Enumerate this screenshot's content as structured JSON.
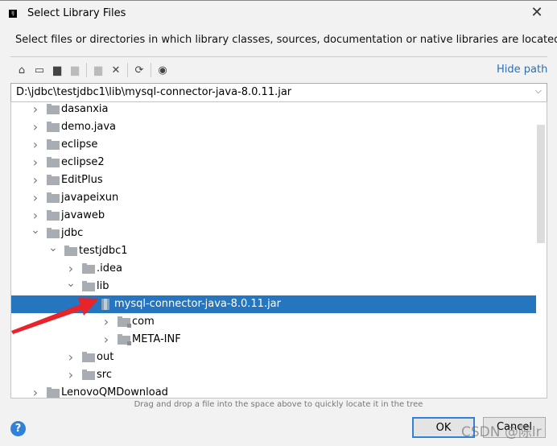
{
  "window": {
    "title": "Select Library Files",
    "close_icon": "close-icon"
  },
  "subtitle": "Select files or directories in which library classes, sources, documentation or native libraries are located",
  "toolbar": {
    "hide_path": "Hide path",
    "icons": [
      "home-icon",
      "desktop-icon",
      "project-folder-icon",
      "module-folder-icon",
      "new-folder-icon",
      "delete-icon",
      "refresh-icon",
      "show-hidden-icon"
    ]
  },
  "path": {
    "value": "D:\\jdbc\\testjdbc1\\lib\\mysql-connector-java-8.0.11.jar"
  },
  "tree": {
    "rows": [
      {
        "label": "dasanxia",
        "level": 0,
        "expanded": false,
        "type": "folder"
      },
      {
        "label": "demo.java",
        "level": 0,
        "expanded": false,
        "type": "folder"
      },
      {
        "label": "eclipse",
        "level": 0,
        "expanded": false,
        "type": "folder"
      },
      {
        "label": "eclipse2",
        "level": 0,
        "expanded": false,
        "type": "folder"
      },
      {
        "label": "EditPlus",
        "level": 0,
        "expanded": false,
        "type": "folder"
      },
      {
        "label": "javapeixun",
        "level": 0,
        "expanded": false,
        "type": "folder"
      },
      {
        "label": "javaweb",
        "level": 0,
        "expanded": false,
        "type": "folder"
      },
      {
        "label": "jdbc",
        "level": 0,
        "expanded": true,
        "type": "folder"
      },
      {
        "label": "testjdbc1",
        "level": 1,
        "expanded": true,
        "type": "folder"
      },
      {
        "label": ".idea",
        "level": 2,
        "expanded": false,
        "type": "folder"
      },
      {
        "label": "lib",
        "level": 2,
        "expanded": true,
        "type": "folder"
      },
      {
        "label": "mysql-connector-java-8.0.11.jar",
        "level": 3,
        "expanded": true,
        "type": "jar",
        "selected": true
      },
      {
        "label": "com",
        "level": 4,
        "expanded": false,
        "type": "package"
      },
      {
        "label": "META-INF",
        "level": 4,
        "expanded": false,
        "type": "package"
      },
      {
        "label": "out",
        "level": 2,
        "expanded": false,
        "type": "folder"
      },
      {
        "label": "src",
        "level": 2,
        "expanded": false,
        "type": "folder"
      },
      {
        "label": "LenovoQMDownload",
        "level": 0,
        "expanded": false,
        "type": "folder"
      }
    ]
  },
  "hint": "Drag and drop a file into the space above to quickly locate it in the tree",
  "buttons": {
    "help": "?",
    "ok": "OK",
    "cancel": "Cancel"
  },
  "watermark": "CSDN @陈lr",
  "colors": {
    "selection": "#2675bf",
    "link": "#2a6fb5",
    "annotation_arrow": "#e8232a"
  }
}
